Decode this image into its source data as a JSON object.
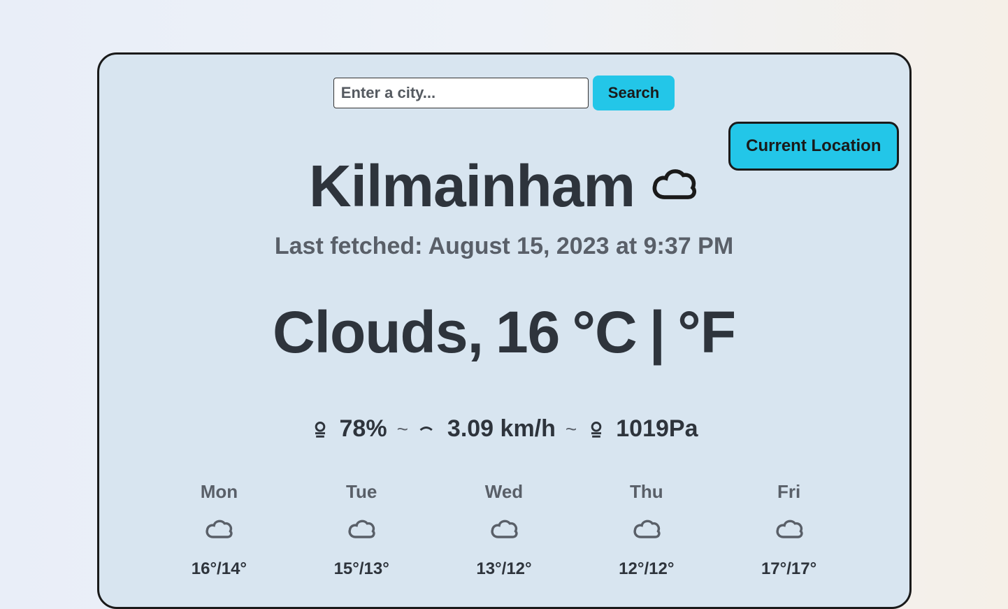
{
  "search": {
    "placeholder": "Enter a city...",
    "button_label": "Search"
  },
  "current_location_label": "Current Location",
  "city": "Kilmainham",
  "last_fetched": "Last fetched: August 15, 2023 at 9:37 PM",
  "condition": {
    "text": "Clouds,",
    "temp": "16",
    "unit_c": "°C",
    "divider": "|",
    "unit_f": "°F"
  },
  "stats": {
    "humidity": "78%",
    "wind": "3.09 km/h",
    "pressure": "1019Pa"
  },
  "forecast": [
    {
      "day": "Mon",
      "temps": "16°/14°"
    },
    {
      "day": "Tue",
      "temps": "15°/13°"
    },
    {
      "day": "Wed",
      "temps": "13°/12°"
    },
    {
      "day": "Thu",
      "temps": "12°/12°"
    },
    {
      "day": "Fri",
      "temps": "17°/17°"
    }
  ]
}
